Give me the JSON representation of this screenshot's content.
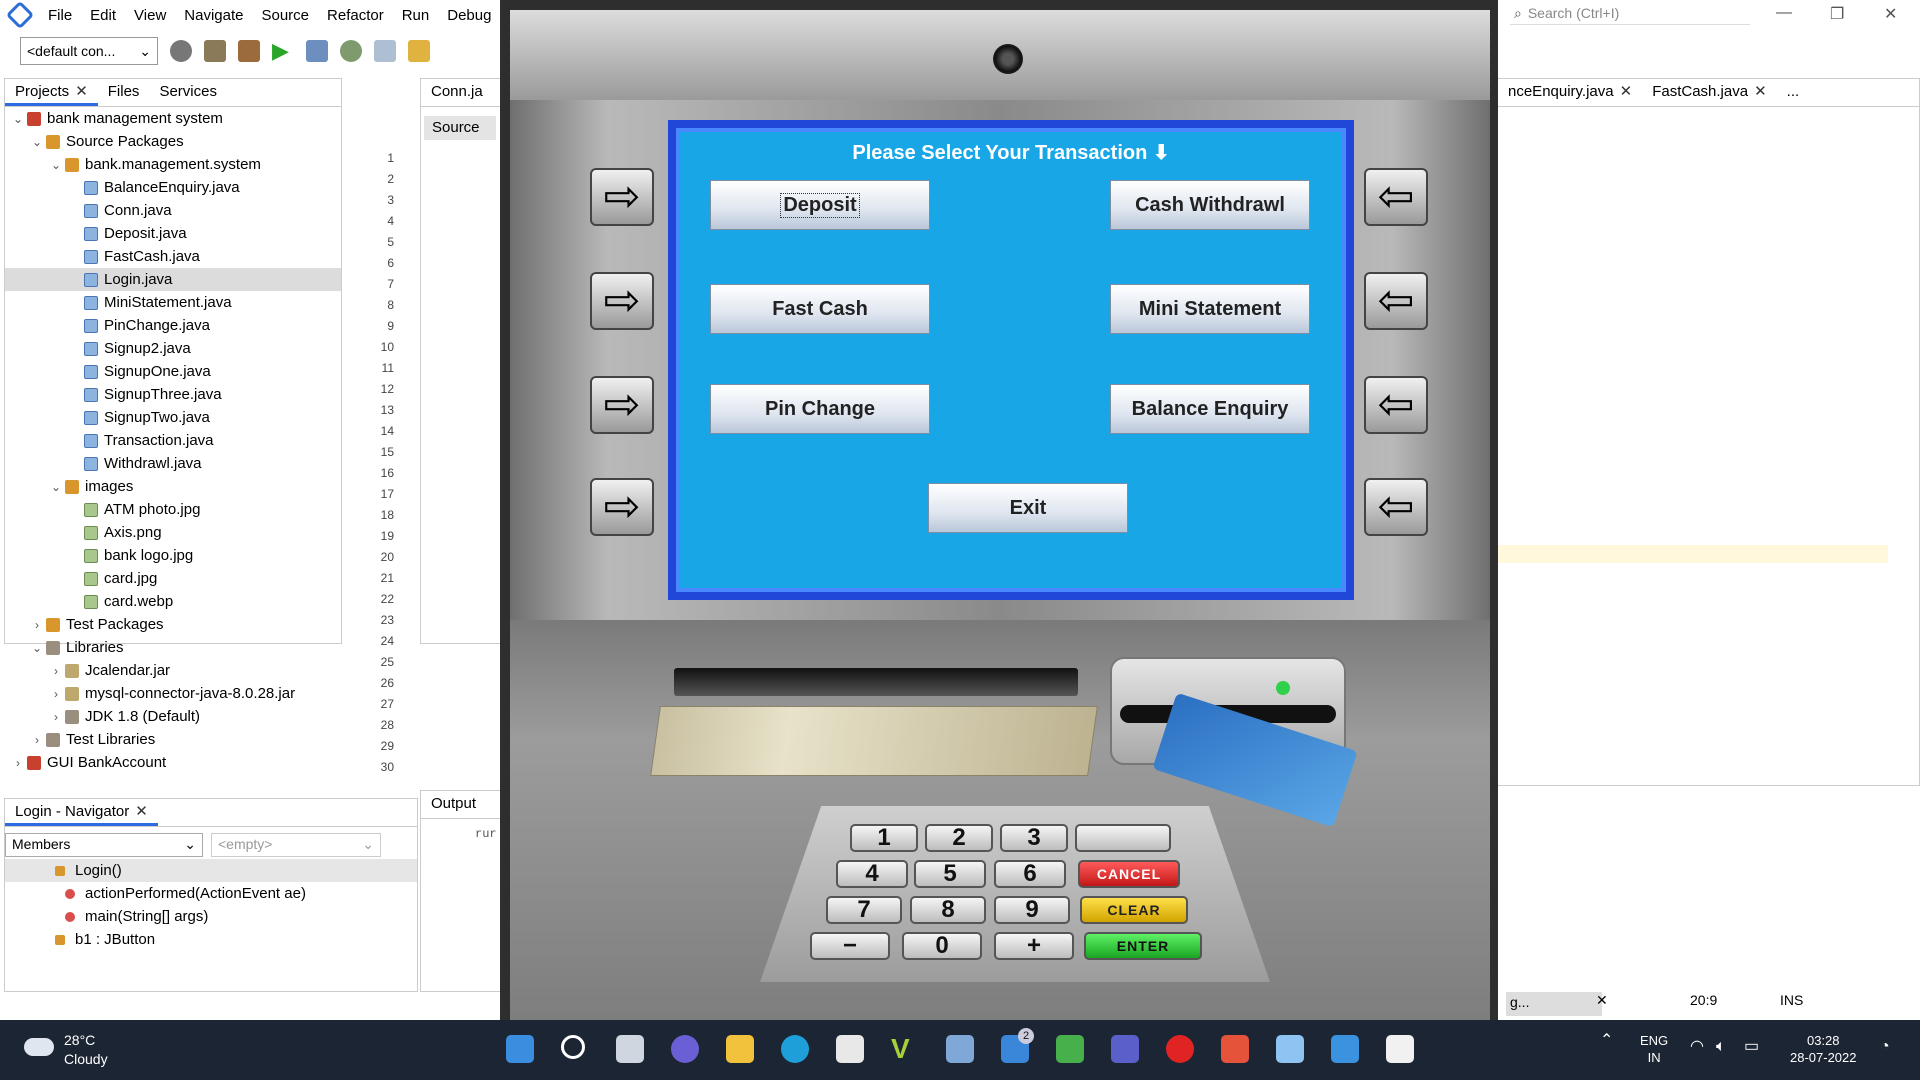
{
  "ide": {
    "menu": [
      "File",
      "Edit",
      "View",
      "Navigate",
      "Source",
      "Refactor",
      "Run",
      "Debug"
    ],
    "search_placeholder": "Search (Ctrl+I)",
    "config_select": "<default con...",
    "project_tabs": [
      "Projects",
      "Files",
      "Services"
    ],
    "tree": [
      {
        "label": "bank management system",
        "level": 0,
        "icon": "project"
      },
      {
        "label": "Source Packages",
        "level": 1,
        "icon": "package-folder"
      },
      {
        "label": "bank.management.system",
        "level": 2,
        "icon": "package"
      },
      {
        "label": "BalanceEnquiry.java",
        "level": 3,
        "icon": "java-file"
      },
      {
        "label": "Conn.java",
        "level": 3,
        "icon": "java-file"
      },
      {
        "label": "Deposit.java",
        "level": 3,
        "icon": "java-file"
      },
      {
        "label": "FastCash.java",
        "level": 3,
        "icon": "java-file"
      },
      {
        "label": "Login.java",
        "level": 3,
        "icon": "java-file",
        "selected": true
      },
      {
        "label": "MiniStatement.java",
        "level": 3,
        "icon": "java-file"
      },
      {
        "label": "PinChange.java",
        "level": 3,
        "icon": "java-file"
      },
      {
        "label": "Signup2.java",
        "level": 3,
        "icon": "java-file"
      },
      {
        "label": "SignupOne.java",
        "level": 3,
        "icon": "java-file"
      },
      {
        "label": "SignupThree.java",
        "level": 3,
        "icon": "java-file"
      },
      {
        "label": "SignupTwo.java",
        "level": 3,
        "icon": "java-file"
      },
      {
        "label": "Transaction.java",
        "level": 3,
        "icon": "java-file"
      },
      {
        "label": "Withdrawl.java",
        "level": 3,
        "icon": "java-file"
      },
      {
        "label": "images",
        "level": 2,
        "icon": "package"
      },
      {
        "label": "ATM photo.jpg",
        "level": 3,
        "icon": "image-file"
      },
      {
        "label": "Axis.png",
        "level": 3,
        "icon": "image-file"
      },
      {
        "label": "bank logo.jpg",
        "level": 3,
        "icon": "image-file"
      },
      {
        "label": "card.jpg",
        "level": 3,
        "icon": "image-file"
      },
      {
        "label": "card.webp",
        "level": 3,
        "icon": "file"
      },
      {
        "label": "Test Packages",
        "level": 1,
        "icon": "package-folder"
      },
      {
        "label": "Libraries",
        "level": 1,
        "icon": "library"
      },
      {
        "label": "Jcalendar.jar",
        "level": 2,
        "icon": "jar"
      },
      {
        "label": "mysql-connector-java-8.0.28.jar",
        "level": 2,
        "icon": "jar"
      },
      {
        "label": "JDK 1.8 (Default)",
        "level": 2,
        "icon": "jdk"
      },
      {
        "label": "Test Libraries",
        "level": 1,
        "icon": "library"
      },
      {
        "label": "GUI BankAccount",
        "level": 0,
        "icon": "project"
      }
    ],
    "editor_tab_left": "Conn.ja",
    "editor_source_tab": "Source",
    "line_numbers": [
      "1",
      "2",
      "3",
      "4",
      "5",
      "6",
      "7",
      "8",
      "9",
      "10",
      "11",
      "12",
      "13",
      "14",
      "15",
      "16",
      "17",
      "18",
      "19",
      "20",
      "21",
      "22",
      "23",
      "24",
      "25",
      "26",
      "27",
      "28",
      "29",
      "30"
    ],
    "editor_tabs_right": [
      "nceEnquiry.java",
      "FastCash.java",
      "..."
    ],
    "navigator_title": "Login - Navigator",
    "navigator_filter": "Members",
    "navigator_empty": "<empty>",
    "navigator_items": [
      {
        "label": "Login()",
        "icon": "constructor"
      },
      {
        "label": "actionPerformed(ActionEvent ae)",
        "icon": "method"
      },
      {
        "label": "main(String[] args)",
        "icon": "method"
      },
      {
        "label": "b1 : JButton",
        "icon": "field"
      }
    ],
    "output_tab": "Output",
    "output_text": "rur",
    "status_position": "20:9",
    "status_mode": "INS",
    "status_progress": "g..."
  },
  "atm": {
    "title": "Please Select Your Transaction ⬇",
    "buttons": {
      "deposit": "Deposit",
      "cash_withdrawl": "Cash Withdrawl",
      "fast_cash": "Fast Cash",
      "mini_statement": "Mini Statement",
      "pin_change": "Pin Change",
      "balance_enquiry": "Balance Enquiry",
      "exit": "Exit"
    },
    "keypad": {
      "k1": "1",
      "k2": "2",
      "k3": "3",
      "k4": "4",
      "k5": "5",
      "k6": "6",
      "k7": "7",
      "k8": "8",
      "k9": "9",
      "minus": "−",
      "k0": "0",
      "plus": "+",
      "cancel": "CANCEL",
      "clear": "CLEAR",
      "enter": "ENTER"
    },
    "colors": {
      "screen": "#19a6e7",
      "frame": "#2147d8"
    }
  },
  "taskbar": {
    "temperature": "28°C",
    "weather": "Cloudy",
    "notification_badge": "2",
    "language": "ENG",
    "region": "IN",
    "time": "03:28",
    "date": "28-07-2022"
  }
}
